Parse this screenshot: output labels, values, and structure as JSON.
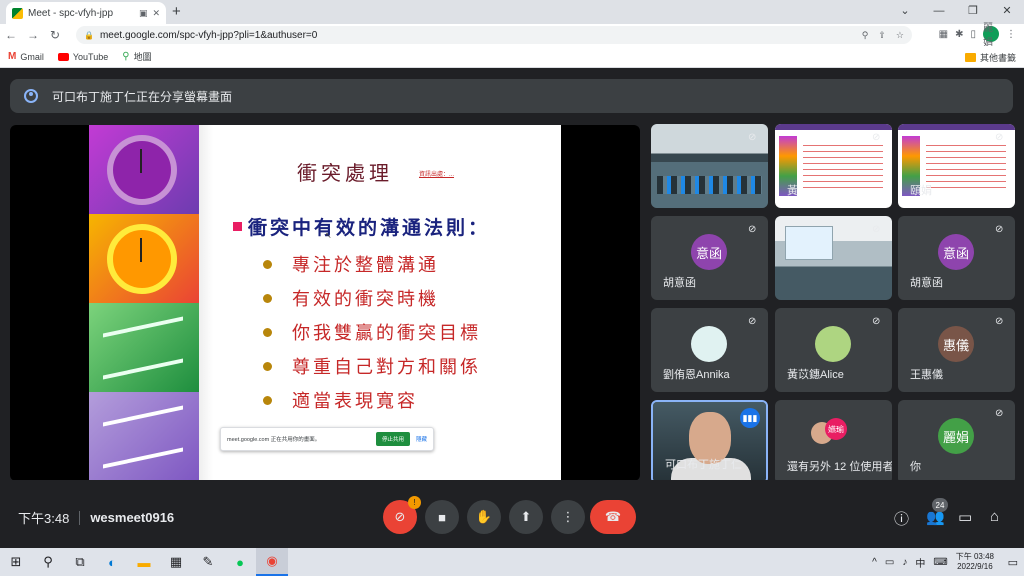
{
  "browser": {
    "tab_title": "Meet - spc-vfyh-jpp",
    "url": "meet.google.com/spc-vfyh-jpp?pli=1&authuser=0",
    "profile_label": "麗娟",
    "bookmarks": [
      {
        "label": "Gmail",
        "icon": "gmail-icon"
      },
      {
        "label": "YouTube",
        "icon": "youtube-icon"
      },
      {
        "label": "地圖",
        "icon": "maps-icon"
      }
    ],
    "other_bookmarks": "其他書籤"
  },
  "banner": {
    "text": "可口布丁施丁仁正在分享螢幕畫面"
  },
  "slide": {
    "title": "衝突處理",
    "credit": "資訊出處：...",
    "heading": "衝突中有效的溝通法則：",
    "bullets": [
      "專注於整體溝通",
      "有效的衝突時機",
      "你我雙贏的衝突目標",
      "尊重自己對方和關係",
      "適當表現寬容"
    ],
    "share_notice": "meet.google.com 正在共用你的畫面。",
    "stop_label": "停止共用",
    "hide_label": "隱藏"
  },
  "tiles": [
    {
      "name": "",
      "type": "classroom"
    },
    {
      "name": "黃",
      "type": "minislide"
    },
    {
      "name": "頤娟",
      "type": "minislide"
    },
    {
      "name": "胡意函",
      "avatar": "意函",
      "color": "#8e44ad"
    },
    {
      "name": "",
      "type": "room"
    },
    {
      "name": "胡意函",
      "avatar": "意函",
      "color": "#8e44ad"
    },
    {
      "name": "劉侑恩Annika",
      "avatar": "",
      "color": "#e0f2f1"
    },
    {
      "name": "黃苡鏸Alice",
      "avatar": "",
      "color": "#aed581"
    },
    {
      "name": "王惠儀",
      "avatar": "惠儀",
      "color": "#795548"
    },
    {
      "name": "可口布丁施丁仁",
      "type": "speaker"
    },
    {
      "name": "還有另外 12 位使用者",
      "avatar": "嬿瑜",
      "color": "#e91e63"
    },
    {
      "name": "你",
      "avatar": "麗娟",
      "color": "#43a047"
    }
  ],
  "controls": {
    "time": "下午3:48",
    "meeting_code": "wesmeet0916",
    "warning_badge": "!",
    "participants_count": "24"
  },
  "taskbar": {
    "ime": "中",
    "time": "下午 03:48",
    "date": "2022/9/16"
  }
}
